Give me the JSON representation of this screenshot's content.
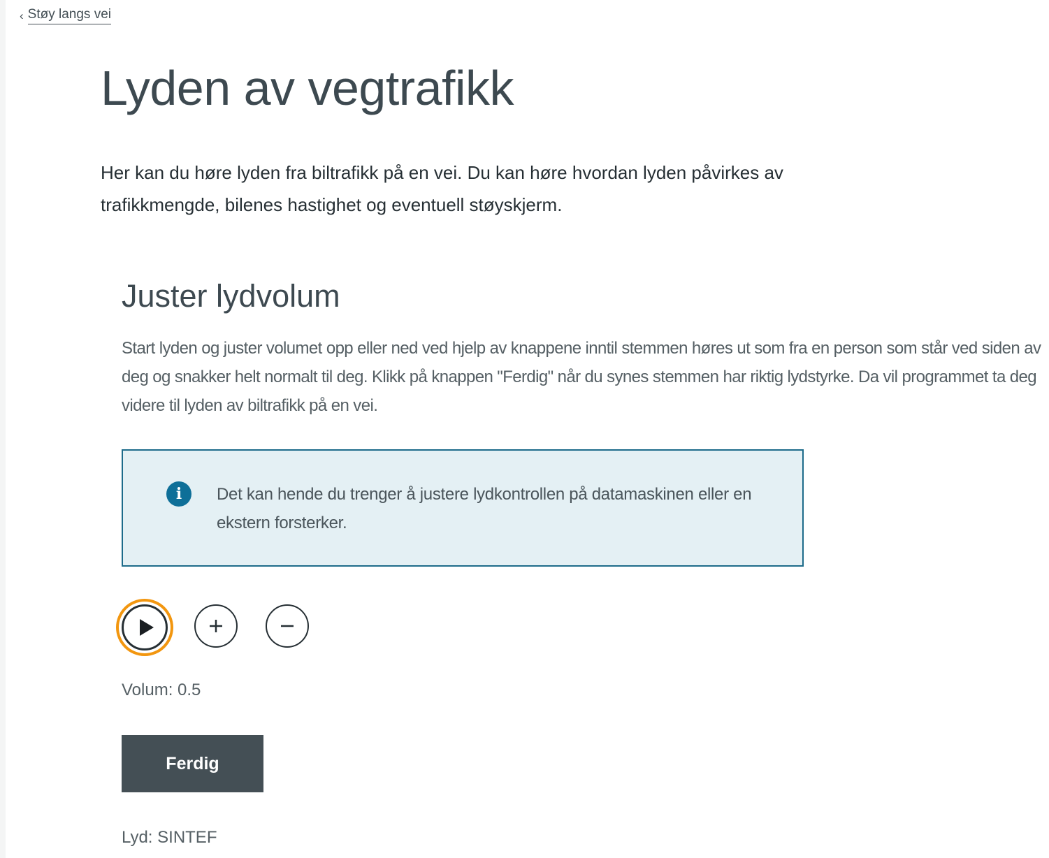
{
  "breadcrumb": {
    "back_label": "Støy langs vei"
  },
  "page": {
    "title": "Lyden av vegtrafikk",
    "ingress": "Her kan du høre lyden fra biltrafikk på en vei. Du kan høre hvordan lyden påvirkes av trafikkmengde, bilenes hastighet og eventuell støyskjerm."
  },
  "volume_section": {
    "heading": "Juster lydvolum",
    "description": "Start lyden og juster volumet opp eller ned ved hjelp av knappene inntil stemmen høres ut som fra en person som står ved siden av deg og snakker helt normalt til deg. Klikk på knappen \"Ferdig\" når du synes stemmen har riktig lydstyrke. Da vil programmet ta deg videre til lyden av biltrafikk på en vei.",
    "info_text": "Det kan hende du trenger å justere lydkontrollen på datamaskinen eller en ekstern forsterker.",
    "volume_text": "Volum: 0.5",
    "done_label": "Ferdig",
    "credit": "Lyd: SINTEF"
  },
  "controls": {
    "play_icon": "play-icon",
    "increase_icon": "plus-icon",
    "decrease_icon": "minus-icon",
    "focus_color": "#f2960f"
  },
  "colors": {
    "info_background": "#e4f0f4",
    "info_border": "#1d6b8a",
    "info_icon": "#0e6f98",
    "button_background": "#444f55"
  }
}
